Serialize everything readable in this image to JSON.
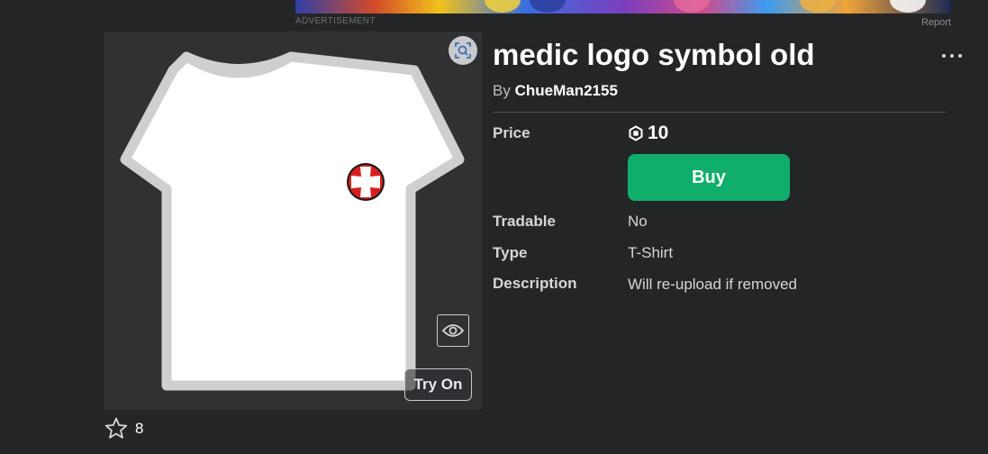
{
  "ad": {
    "label": "ADVERTISEMENT",
    "report_label": "Report"
  },
  "item": {
    "title": "medic logo symbol old",
    "creator_prefix": "By",
    "creator_name": "ChueMan2155"
  },
  "thumbnail": {
    "try_on_label": "Try On",
    "shirt_color": "#ffffff",
    "outline_color": "#cfcfcf",
    "logo_ring_color": "#d6201f",
    "logo_cross_color": "#ffffff"
  },
  "favorites": {
    "count": "8"
  },
  "details": {
    "price": {
      "label": "Price",
      "amount": "10",
      "currency_icon": "robux-icon"
    },
    "buy_label": "Buy",
    "tradable": {
      "label": "Tradable",
      "value": "No"
    },
    "type": {
      "label": "Type",
      "value": "T-Shirt"
    },
    "description": {
      "label": "Description",
      "value": "Will re-upload if removed"
    }
  },
  "colors": {
    "background": "#232527",
    "panel": "#2f3133",
    "buy_button": "#0fae6b"
  }
}
